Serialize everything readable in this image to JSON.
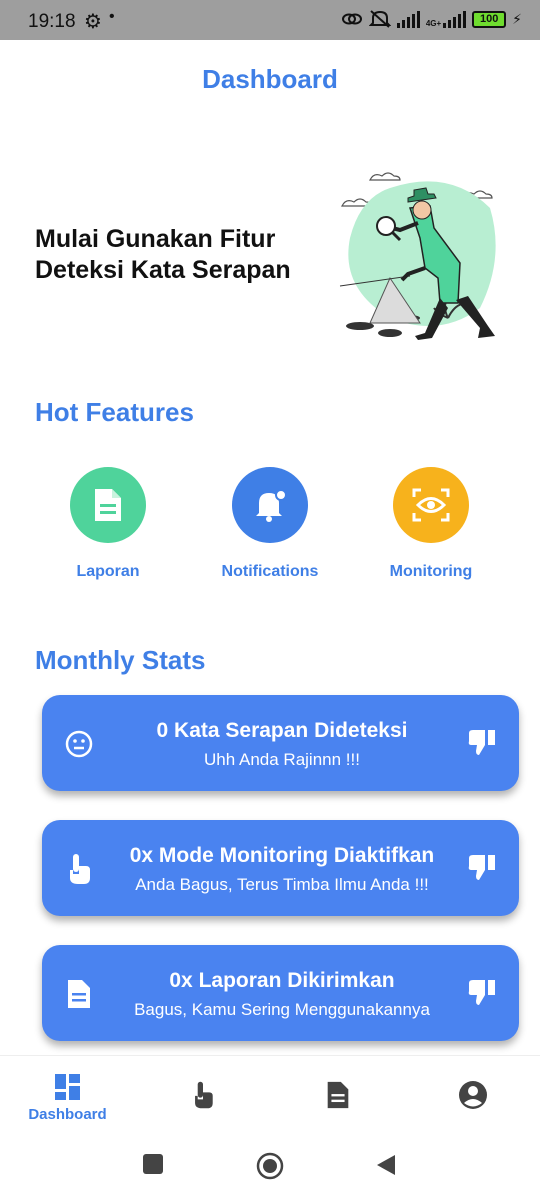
{
  "status_bar": {
    "time": "19:18",
    "battery": "100",
    "network": "4G+"
  },
  "header": {
    "title": "Dashboard"
  },
  "hero": {
    "line1": "Mulai Gunakan Fitur",
    "line2": "Deteksi Kata Serapan"
  },
  "hot_features": {
    "title": "Hot Features",
    "items": [
      {
        "label": "Laporan",
        "color": "#4fd39b",
        "icon": "document-icon"
      },
      {
        "label": "Notifications",
        "color": "#3f7fe6",
        "icon": "bell-icon"
      },
      {
        "label": "Monitoring",
        "color": "#f7b21c",
        "icon": "eye-scan-icon"
      }
    ]
  },
  "monthly_stats": {
    "title": "Monthly Stats",
    "cards": [
      {
        "title": "0 Kata Serapan Dideteksi",
        "subtitle": "Uhh Anda Rajinnn !!!",
        "icon": "smiley-icon"
      },
      {
        "title": "0x Mode Monitoring Diaktifkan",
        "subtitle": "Anda Bagus, Terus Timba Ilmu Anda !!!",
        "icon": "touch-icon"
      },
      {
        "title": "0x Laporan Dikirimkan",
        "subtitle": "Bagus, Kamu Sering Menggunakannya",
        "icon": "document-icon"
      }
    ]
  },
  "bottom_nav": {
    "items": [
      {
        "label": "Dashboard",
        "icon": "dashboard-icon",
        "active": true
      },
      {
        "label": "",
        "icon": "touch-icon",
        "active": false
      },
      {
        "label": "",
        "icon": "document-icon",
        "active": false
      },
      {
        "label": "",
        "icon": "account-icon",
        "active": false
      }
    ]
  },
  "colors": {
    "accent": "#3f7fe6",
    "card": "#4a83f0",
    "green": "#4fd39b",
    "orange": "#f7b21c"
  }
}
